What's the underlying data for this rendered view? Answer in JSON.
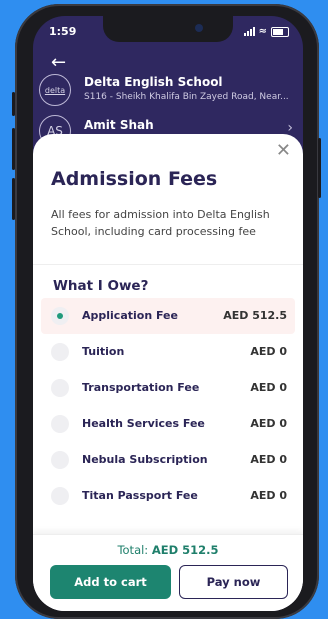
{
  "status_bar": {
    "time": "1:59"
  },
  "school": {
    "logo_text": "delta",
    "name": "Delta English School",
    "address": "S116 - Sheikh Khalifa Bin Zayed Road, Near..."
  },
  "student": {
    "initials": "AS",
    "name": "Amit Shah"
  },
  "sheet": {
    "title": "Admission Fees",
    "description": "All fees for admission into Delta English School, including card processing fee",
    "section_title": "What I Owe?",
    "fees": [
      {
        "name": "Application Fee",
        "amount": "AED 512.5",
        "selected": true
      },
      {
        "name": "Tuition",
        "amount": "AED 0",
        "selected": false
      },
      {
        "name": "Transportation Fee",
        "amount": "AED 0",
        "selected": false
      },
      {
        "name": "Health Services Fee",
        "amount": "AED 0",
        "selected": false
      },
      {
        "name": "Nebula Subscription",
        "amount": "AED 0",
        "selected": false
      },
      {
        "name": "Titan Passport Fee",
        "amount": "AED 0",
        "selected": false
      }
    ]
  },
  "footer": {
    "total_label": "Total:",
    "total_value": "AED 512.5",
    "add_to_cart_label": "Add to cart",
    "pay_now_label": "Pay now"
  },
  "colors": {
    "background": "#2f8ef0",
    "header": "#2f2860",
    "accent_green": "#1d8570",
    "selected_row": "#fdf1f0",
    "navy_text": "#2b2556"
  },
  "icons": {
    "back": "arrow-left-icon",
    "close": "close-icon",
    "chevron": "chevron-right-icon"
  }
}
